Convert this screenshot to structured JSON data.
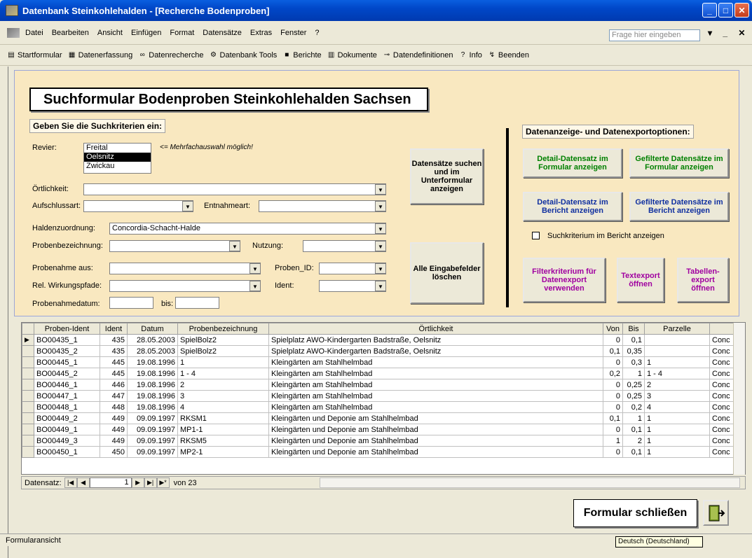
{
  "window": {
    "title": "Datenbank Steinkohlehalden - [Recherche Bodenproben]"
  },
  "menu": {
    "items": [
      "Datei",
      "Bearbeiten",
      "Ansicht",
      "Einfügen",
      "Format",
      "Datensätze",
      "Extras",
      "Fenster",
      "?"
    ],
    "ask_placeholder": "Frage hier eingeben"
  },
  "toolbar": {
    "items": [
      {
        "label": "Startformular",
        "icon": "form-icon"
      },
      {
        "label": "Datenerfassung",
        "icon": "table-icon"
      },
      {
        "label": "Datenrecherche",
        "icon": "binoculars-icon"
      },
      {
        "label": "Datenbank Tools",
        "icon": "tools-icon"
      },
      {
        "label": "Berichte",
        "icon": "report-icon"
      },
      {
        "label": "Dokumente",
        "icon": "document-icon"
      },
      {
        "label": "Datendefinitionen",
        "icon": "key-icon"
      },
      {
        "label": "Info",
        "icon": "help-icon"
      },
      {
        "label": "Beenden",
        "icon": "exit-icon"
      }
    ]
  },
  "form": {
    "title": "Suchformular Bodenproben Steinkohlehalden Sachsen",
    "criteria_heading": "Geben Sie die Suchkriterien ein:",
    "revier_label": "Revier:",
    "revier_options": [
      "Freital",
      "Oelsnitz",
      "Zwickau"
    ],
    "revier_selected": "Oelsnitz",
    "multi_hint": "<= Mehrfachauswahl möglich!",
    "oertlichkeit_label": "Örtlichkeit:",
    "aufschlussart_label": "Aufschlussart:",
    "entnahmeart_label": "Entnahmeart:",
    "haldenzuordnung_label": "Haldenzuordnung:",
    "haldenzuordnung_value": "Concordia-Schacht-Halde",
    "probenbezeichnung_label": "Probenbezeichnung:",
    "nutzung_label": "Nutzung:",
    "probenahme_label": "Probenahme aus:",
    "proben_id_label": "Proben_ID:",
    "wirkungspfade_label": "Rel. Wirkungspfade:",
    "ident_label": "Ident:",
    "datum_label": "Probenahmedatum:",
    "bis_label": "bis:",
    "search_button": "Datensätze suchen und im Unterformular anzeigen",
    "clear_button": "Alle Eingabefelder löschen",
    "export_heading": "Datenanzeige- und Datenexportoptionen:",
    "btn_detail_form": "Detail-Datensatz im Formular anzeigen",
    "btn_filtered_form": "Gefilterte Datensätze im Formular anzeigen",
    "btn_detail_report": "Detail-Datensatz im Bericht anzeigen",
    "btn_filtered_report": "Gefilterte Datensätze im Bericht anzeigen",
    "checkbox_label": "Suchkriterium im Bericht anzeigen",
    "btn_filter_export": "Filterkriterium für Datenexport verwenden",
    "btn_text_export": "Textexport öffnen",
    "btn_table_export": "Tabellen-export öffnen"
  },
  "grid": {
    "columns": [
      "Proben-Ident",
      "Ident",
      "Datum",
      "Probenbezeichnung",
      "Örtlichkeit",
      "Von",
      "Bis",
      "Parzelle",
      ""
    ],
    "rows": [
      [
        "BO00435_1",
        "435",
        "28.05.2003",
        "SpielBolz2",
        "Spielplatz AWO-Kindergarten Badstraße, Oelsnitz",
        "0",
        "0,1",
        "",
        "Conc"
      ],
      [
        "BO00435_2",
        "435",
        "28.05.2003",
        "SpielBolz2",
        "Spielplatz AWO-Kindergarten Badstraße, Oelsnitz",
        "0,1",
        "0,35",
        "",
        "Conc"
      ],
      [
        "BO00445_1",
        "445",
        "19.08.1996",
        "1",
        "Kleingärten am Stahlhelmbad",
        "0",
        "0,3",
        "1",
        "Conc"
      ],
      [
        "BO00445_2",
        "445",
        "19.08.1996",
        "1 - 4",
        "Kleingärten am Stahlhelmbad",
        "0,2",
        "1",
        "1 - 4",
        "Conc"
      ],
      [
        "BO00446_1",
        "446",
        "19.08.1996",
        "2",
        "Kleingärten am Stahlhelmbad",
        "0",
        "0,25",
        "2",
        "Conc"
      ],
      [
        "BO00447_1",
        "447",
        "19.08.1996",
        "3",
        "Kleingärten am Stahlhelmbad",
        "0",
        "0,25",
        "3",
        "Conc"
      ],
      [
        "BO00448_1",
        "448",
        "19.08.1996",
        "4",
        "Kleingärten am Stahlhelmbad",
        "0",
        "0,2",
        "4",
        "Conc"
      ],
      [
        "BO00449_2",
        "449",
        "09.09.1997",
        "RKSM1",
        "Kleingärten und Deponie am Stahlhelmbad",
        "0,1",
        "1",
        "1",
        "Conc"
      ],
      [
        "BO00449_1",
        "449",
        "09.09.1997",
        "MP1-1",
        "Kleingärten und Deponie am Stahlhelmbad",
        "0",
        "0,1",
        "1",
        "Conc"
      ],
      [
        "BO00449_3",
        "449",
        "09.09.1997",
        "RKSM5",
        "Kleingärten und Deponie am Stahlhelmbad",
        "1",
        "2",
        "1",
        "Conc"
      ],
      [
        "BO00450_1",
        "450",
        "09.09.1997",
        "MP2-1",
        "Kleingärten und Deponie am Stahlhelmbad",
        "0",
        "0,1",
        "1",
        "Conc"
      ]
    ],
    "nav_label": "Datensatz:",
    "current_record": "1",
    "total_label": "von 23"
  },
  "close_button": "Formular schließen",
  "status": {
    "text": "Formularansicht",
    "language": "Deutsch (Deutschland)"
  }
}
